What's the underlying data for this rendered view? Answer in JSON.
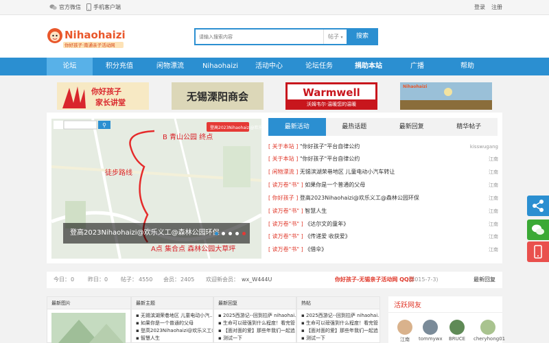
{
  "topbar": {
    "wechat": "官方微信",
    "mobile": "手机客户端",
    "login": "登录",
    "register": "注册"
  },
  "logo": {
    "name": "Nihaohaizi",
    "slogan": "你好孩子·南通亲子活动网"
  },
  "search": {
    "placeholder": "请输入搜索内容",
    "scope": "帖子",
    "button": "搜索"
  },
  "nav": [
    "论坛",
    "积分充值",
    "闲物漂流",
    "Nihaohaizi",
    "活动中心",
    "论坛任务",
    "捐助本站",
    "广播",
    "帮助"
  ],
  "banners": [
    "你好孩子 家长讲堂",
    "无锡溧阳商会",
    "Warmwell 沃姆韦尔·温暖您的温暖",
    "Nihaohaizi"
  ],
  "slider": {
    "caption": "登高2023Nihaohaizi@欢乐义工@森林公园环保",
    "map_labels": [
      "B 青山公园 终点",
      "徒步路线",
      "A点 集合点 森林公园大草坪",
      "登高2023Nihaohaizi@欢乐义工@森林公园环保"
    ],
    "pager": [
      "1",
      "2",
      "3",
      "4",
      "5"
    ]
  },
  "tabs": [
    "最新活动",
    "最热话题",
    "最新回复",
    "精华帖子"
  ],
  "posts": [
    {
      "cat": "[ 关于本站 ]",
      "title": "\"你好孩子\"平台自律公约",
      "author": "kisswugang"
    },
    {
      "cat": "[ 关于本站 ]",
      "title": "\"你好孩子\"平台自律公约",
      "author": "江南"
    },
    {
      "cat": "[ 闲物漂流 ]",
      "title": "无锡滨湖荣巷地区 儿童电动小汽车转让",
      "author": "江南"
    },
    {
      "cat": "[ 读万卷\"书\" ]",
      "title": "如果你是一个普通的父母",
      "author": "江南"
    },
    {
      "cat": "[ 你好孩子 ]",
      "title": "登高2023Nihaohaizi@欢乐义工@森林公园环保",
      "author": "江南"
    },
    {
      "cat": "[ 读万卷\"书\" ]",
      "title": "智慧人生",
      "author": "江南"
    },
    {
      "cat": "[ 读万卷\"书\" ]",
      "title": "《达尔文的童年》",
      "author": "江南"
    },
    {
      "cat": "[ 读万卷\"书\" ]",
      "title": "《传递爱 收获爱》",
      "author": "江南"
    },
    {
      "cat": "[ 读万卷\"书\" ]",
      "title": "《借伞》",
      "author": "江南"
    }
  ],
  "stats": {
    "today_label": "今日：",
    "today": "0",
    "yesterday_label": "昨日：",
    "yesterday": "0",
    "posts_label": "帖子：",
    "posts": "4550",
    "members_label": "会员：",
    "members": "2405",
    "welcome_label": "欢迎新会员：",
    "new_member": "wx_W444U",
    "highlight": "你好孩子-无锡亲子活动网 QQ群",
    "highlight_date": "(2015-7-3)",
    "latest_reply": "最新回复"
  },
  "bottom": {
    "cols": [
      {
        "title": "最新图片",
        "items": []
      },
      {
        "title": "最新主题",
        "items": [
          "无锡滨湖荣巷地区 儿童电动小汽...",
          "如果你是一个普通的父母",
          "登高2023Nihaohaizi@欢乐义工@...",
          "智慧人生"
        ]
      },
      {
        "title": "最新回复",
        "items": [
          "2025西游记--回到拉萨 nihaohai...",
          "生命可以磅强到什么程度！看完管",
          "【面对面的爱】那些年我们一起追",
          "测试一下"
        ]
      },
      {
        "title": "热帖",
        "items": [
          "2025西游记--回到拉萨 nihaohai...",
          "生命可以磅强到什么程度！看完管",
          "【面对面的爱】那些年我们一起追",
          "测试一下"
        ]
      }
    ],
    "friends_title": "活跃网友",
    "friends": [
      "江南",
      "tommywx",
      "BRUCE",
      "cheryhong01"
    ]
  },
  "colors": {
    "accent": "#2b8fd1",
    "nav_active": "#58b1e8",
    "category": "#e0382a",
    "share": "#2b8fd1",
    "wechat": "#3aa935",
    "mobile": "#e9504d"
  },
  "icons": [
    "wechat-icon",
    "mobile-icon",
    "search-icon",
    "share-icon",
    "mobile-side-icon"
  ]
}
